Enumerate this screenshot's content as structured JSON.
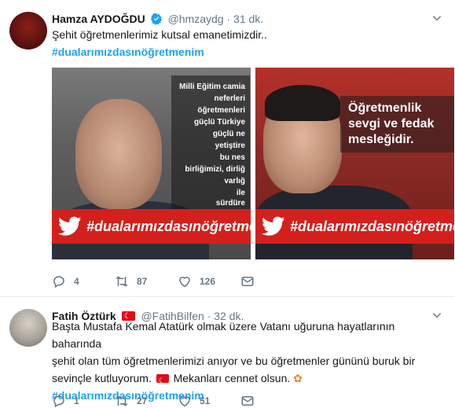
{
  "tweets": [
    {
      "name": "Hamza AYDOĞDU",
      "handle": "@hmzaydg",
      "separator": "·",
      "time": "31 dk.",
      "text_line1": "Şehit öğretmenlerimiz kutsal emanetimizdir..",
      "hashtag": "#dualarımızdasınöğretmenim",
      "media": {
        "left": {
          "quote_lines": [
            "Milli Eğitim camia",
            "neferleri",
            "öğretmenleri",
            "güçlü Türkiye",
            "güçlü ne",
            "yetiştire",
            "bu nes",
            "birliğimizi, dirliğ",
            "varlığ",
            "ile",
            "sürdüre"
          ],
          "banner_text": "#dualarımızdasınöğretmen"
        },
        "right": {
          "quote_lines": [
            "Öğretmenlik",
            "sevgi ve fedak",
            "mesleğidir."
          ],
          "banner_text": "#dualarımızdasınöğretme"
        }
      },
      "actions": {
        "reply": "4",
        "retweet": "87",
        "like": "126"
      }
    },
    {
      "name": "Fatih Öztürk",
      "handle": "@FatihBilfen",
      "separator": "·",
      "time": "32 dk.",
      "text_line1": "Başta Mustafa Kemal Atatürk olmak üzere Vatanı uğuruna hayatlarının baharında",
      "text_line2": "şehit olan tüm öğretmenlerimizi anıyor ve bu öğretmenler gününü buruk bir",
      "text_line3a": "sevinçle kutluyorum.",
      "text_line3b": "Mekanları cennet olsun.",
      "hashtag": "#dualarımızdasınöğretmenim",
      "actions": {
        "reply": "1",
        "retweet": "27",
        "like": "51"
      }
    }
  ],
  "colors": {
    "accent": "#1da1f2",
    "muted": "#657786",
    "banner_red": "#d3201c",
    "verified": "#1da1f2"
  },
  "icons": [
    "verified-badge-icon",
    "chevron-down-icon",
    "reply-icon",
    "retweet-icon",
    "like-icon",
    "direct-message-icon",
    "twitter-bird-icon",
    "turkish-flag-icon",
    "flowers-icon"
  ]
}
